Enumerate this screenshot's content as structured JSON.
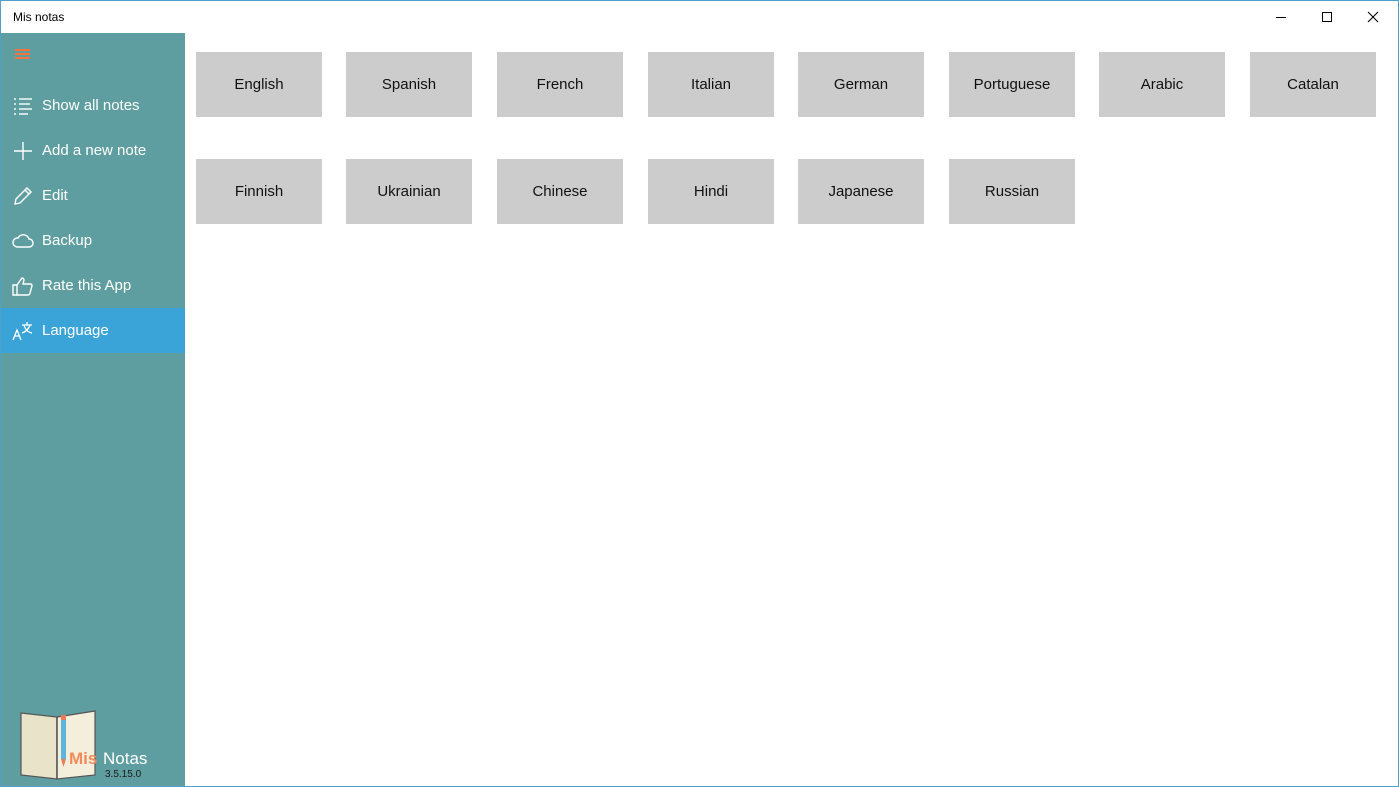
{
  "window": {
    "title": "Mis notas"
  },
  "sidebar": {
    "items": [
      {
        "label": "Show all notes",
        "icon": "list-icon"
      },
      {
        "label": "Add a new note",
        "icon": "plus-icon"
      },
      {
        "label": "Edit",
        "icon": "pencil-icon"
      },
      {
        "label": "Backup",
        "icon": "cloud-icon"
      },
      {
        "label": "Rate this App",
        "icon": "thumbs-up-icon"
      },
      {
        "label": "Language",
        "icon": "language-icon",
        "active": true
      }
    ],
    "logo": {
      "mis": "Mis",
      "notas": "Notas",
      "version": "3.5.15.0"
    }
  },
  "languages": [
    "English",
    "Spanish",
    "French",
    "Italian",
    "German",
    "Portuguese",
    "Arabic",
    "Catalan",
    "Finnish",
    "Ukrainian",
    "Chinese",
    "Hindi",
    "Japanese",
    "Russian"
  ],
  "colors": {
    "sidebar": "#5f9ea0",
    "active_item": "#3aa3d8",
    "accent": "#f0743e",
    "button": "#cccccc"
  }
}
